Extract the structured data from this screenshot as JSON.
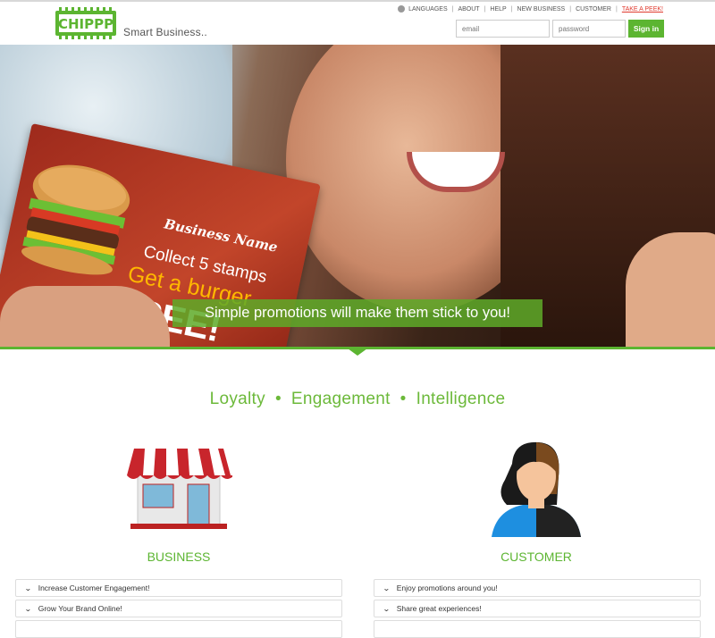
{
  "brand": {
    "name": "CHIPPP",
    "tagline": "Smart Business..",
    "color": "#5cb531"
  },
  "topnav": {
    "items": [
      {
        "label": "LANGUAGES"
      },
      {
        "label": "ABOUT"
      },
      {
        "label": "HELP"
      },
      {
        "label": "NEW BUSINESS"
      },
      {
        "label": "CUSTOMER"
      },
      {
        "label": "TAKE A PEEK!"
      }
    ]
  },
  "login": {
    "email_placeholder": "email",
    "password_placeholder": "password",
    "signin_label": "Sign in"
  },
  "hero": {
    "card_business": "Business Name",
    "card_collect": "Collect 5 stamps",
    "card_get": "Get a burger",
    "card_free": "FREE!",
    "banner": "Simple promotions will make them stick to you!"
  },
  "pillars": [
    "Loyalty",
    "Engagement",
    "Intelligence"
  ],
  "business": {
    "title": "BUSINESS",
    "items": [
      "Increase Customer Engagement!",
      "Grow Your Brand Online!"
    ]
  },
  "customer": {
    "title": "CUSTOMER",
    "items": [
      "Enjoy promotions around you!",
      "Share great experiences!"
    ]
  }
}
